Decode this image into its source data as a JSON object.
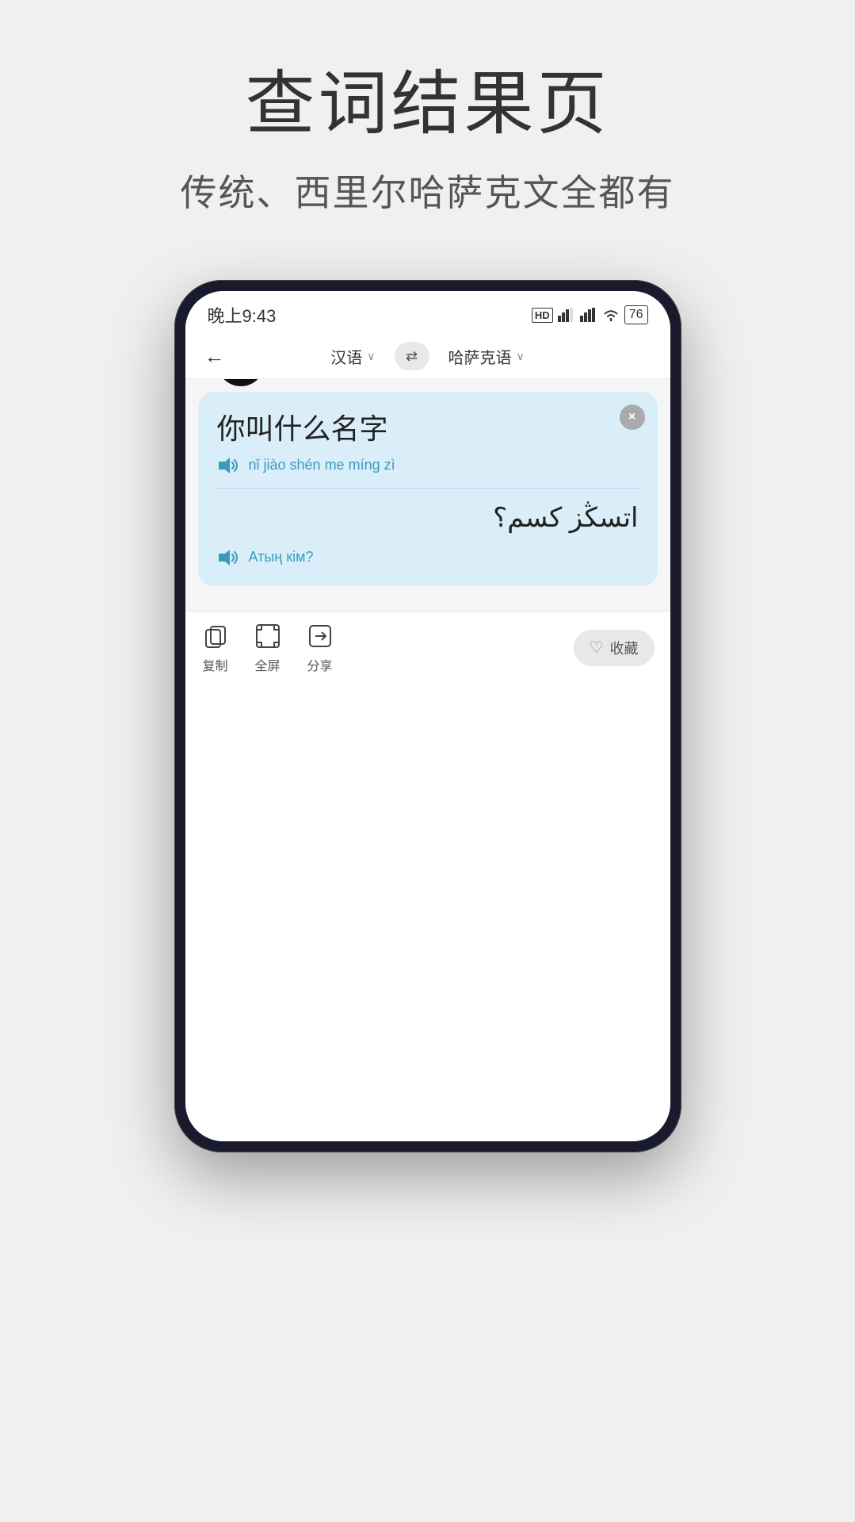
{
  "page": {
    "title": "查词结果页",
    "subtitle": "传统、西里尔哈萨克文全都有"
  },
  "phone": {
    "status_bar": {
      "time": "晚上9:43",
      "hd1": "HD",
      "hd2": "HD",
      "battery": "76"
    },
    "nav": {
      "source_lang": "汉语",
      "target_lang": "哈萨克语",
      "swap_symbol": "⇌"
    },
    "card": {
      "source_text": "你叫什么名字",
      "pinyin": "nǐ jiào shén me míng zì",
      "arabic_kazakh": "اتسڭز كسم؟",
      "latin_kazakh": "Атың кім?",
      "close_label": "×"
    },
    "toolbar": {
      "copy_label": "复制",
      "fullscreen_label": "全屏",
      "share_label": "分享",
      "favorite_label": "收藏"
    }
  }
}
